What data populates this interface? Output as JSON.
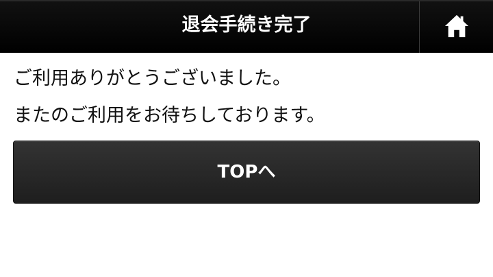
{
  "header": {
    "title": "退会手続き完了",
    "home_icon": "home-icon"
  },
  "main": {
    "message_line1": "ご利用ありがとうございました。",
    "message_line2": "またのご利用をお待ちしております。",
    "top_button_label": "TOPへ"
  },
  "colors": {
    "header_bg": "#000000",
    "button_bg": "#2a2a2a",
    "text": "#111111",
    "header_text": "#ffffff"
  }
}
